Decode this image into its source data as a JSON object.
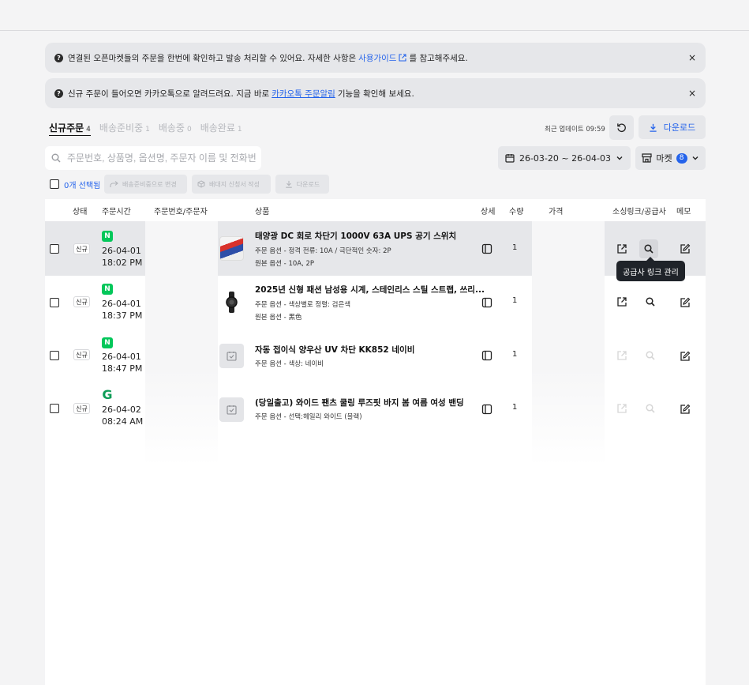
{
  "notices": [
    {
      "text_before": "연결된 오픈마켓들의 주문을 한번에 확인하고 발송 처리할 수 있어요. 자세한 사항은",
      "link": "사용가이드",
      "text_after": "를 참고해주세요.",
      "close": "×"
    },
    {
      "text_before": "신규 주문이 들어오면 카카오톡으로 알려드려요. 지금 바로",
      "link": "카카오톡 주문알림",
      "text_after": "기능을 확인해 보세요.",
      "close": "×"
    }
  ],
  "tabs": [
    {
      "label": "신규주문",
      "count": "4"
    },
    {
      "label": "배송준비중",
      "count": "1"
    },
    {
      "label": "배송중",
      "count": "0"
    },
    {
      "label": "배송완료",
      "count": "1"
    }
  ],
  "toolbar": {
    "last_update": "최근 업데이트 09:59",
    "download_label": "다운로드",
    "search_placeholder": "주문번호, 상품명, 옵션명, 주문자 이름 및 전화번호",
    "date_range": "26-03-20 ~ 26-04-03",
    "market_label": "마켓",
    "market_count": "8"
  },
  "actions": {
    "selected": "0개 선택됨",
    "to_preparing": "배송준비중으로 변경",
    "invoice": "배대지 신청서 작성",
    "download": "다운로드"
  },
  "columns": [
    "상태",
    "주문시간",
    "주문번호/주문자",
    "상품",
    "상세",
    "수량",
    "가격",
    "소싱링크/공급사",
    "메모"
  ],
  "orders": [
    {
      "status": "신규",
      "market_icon": "naver-icon",
      "date": "26-04-01",
      "time": "18:02 PM",
      "product": "태양광 DC 회로 차단기 1000V 63A UPS 공기 스위치",
      "opt1": "주문 옵션 - 정격 전류: 10A / 극단적인 숫자: 2P",
      "opt2": "원본 옵션 - 10A, 2P",
      "qty": "1",
      "links_enabled": true
    },
    {
      "status": "신규",
      "market_icon": "naver-icon",
      "date": "26-04-01",
      "time": "18:37 PM",
      "product": "2025년 신형 패션 남성용 시계, 스테인리스 스틸 스트랩, 쓰리...",
      "opt1": "주문 옵션 - 색상별로 정렬: 검은색",
      "opt2": "원본 옵션 - 黑色",
      "qty": "1",
      "links_enabled": true
    },
    {
      "status": "신규",
      "market_icon": "naver-icon",
      "date": "26-04-01",
      "time": "18:47 PM",
      "product": "자동 접이식 양우산 UV 차단 KK852 네이비",
      "opt1": "주문 옵션 - 색상: 네이비",
      "opt2": "",
      "qty": "1",
      "links_enabled": false
    },
    {
      "status": "신규",
      "market_icon": "google-icon",
      "date": "26-04-02",
      "time": "08:24 AM",
      "product": "(당일출고) 와이드 팬츠 쿨링 루즈핏 바지 봄 여름 여성 밴딩",
      "opt1": "주문 옵션 - 선택:헤일리 와이드 (블랙)",
      "opt2": "",
      "qty": "1",
      "links_enabled": false
    }
  ],
  "tooltip": "공급사 링크 관리",
  "colors": {
    "accent": "#2463eb",
    "naver": "#03c75a",
    "google": "#0f9d58"
  }
}
